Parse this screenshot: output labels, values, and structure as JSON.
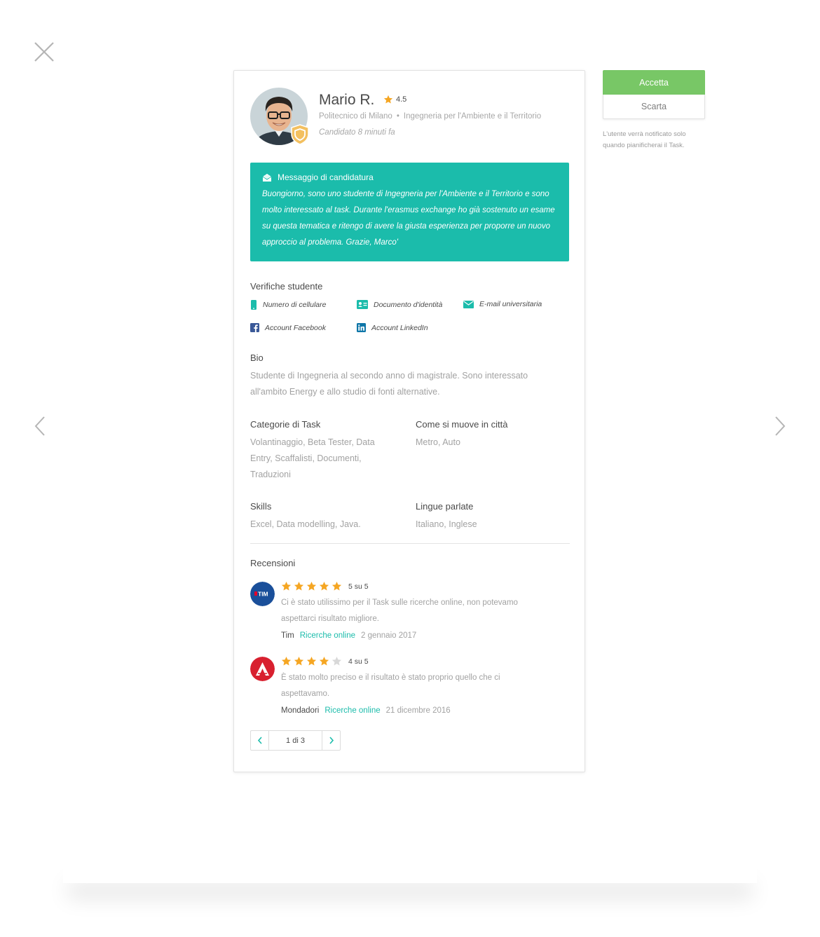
{
  "candidate": {
    "name": "Mario R.",
    "rating": "4.5",
    "university": "Politecnico di Milano",
    "separator": "•",
    "course": "Ingegneria per l'Ambiente e il Territorio",
    "applied": "Candidato 8 minuti fa"
  },
  "message": {
    "title": "Messaggio di candidatura",
    "text": "Buongiorno, sono uno studente di Ingegneria per l'Ambiente e il Territorio e sono molto interessato al task. Durante l'erasmus exchange ho già sostenuto un esame su questa tematica e ritengo di avere la giusta esperienza per proporre un nuovo approccio al problema. Grazie, Marco'"
  },
  "verifications": {
    "title": "Verifiche studente",
    "phone": "Numero di cellulare",
    "id_doc": "Documento d'identità",
    "email": "E-mail universitaria",
    "facebook": "Account Facebook",
    "linkedin": "Account LinkedIn"
  },
  "bio": {
    "title": "Bio",
    "text": "Studente di Ingegneria al secondo anno di magistrale. Sono interessato all'ambito Energy e allo studio di fonti alternative."
  },
  "categories": {
    "title": "Categorie di Task",
    "text": "Volantinaggio, Beta Tester, Data Entry, Scaffalisti, Documenti, Traduzioni"
  },
  "transport": {
    "title": "Come si muove in città",
    "text": "Metro, Auto"
  },
  "skills": {
    "title": "Skills",
    "text": "Excel, Data modelling, Java."
  },
  "languages": {
    "title": "Lingue parlate",
    "text": "Italiano, Inglese"
  },
  "reviews": {
    "title": "Recensioni",
    "items": [
      {
        "logo_text": "TIM",
        "stars": 5,
        "score": "5 su 5",
        "text": "Ci è stato utilissimo per il Task sulle ricerche online, non potevamo aspettarci risultato migliore.",
        "company": "Tim",
        "category": "Ricerche online",
        "date": "2 gennaio 2017"
      },
      {
        "logo_text": "",
        "stars": 4,
        "score": "4 su 5",
        "text": "È stato molto preciso e il risultato è stato proprio quello che ci aspettavamo.",
        "company": "Mondadori",
        "category": "Ricerche online",
        "date": "21 dicembre 2016"
      }
    ],
    "pager": "1 di 3"
  },
  "actions": {
    "accept": "Accetta",
    "discard": "Scarta",
    "note": "L'utente verrà notificato solo quando pianificherai il Task."
  },
  "colors": {
    "teal": "#1bbcab",
    "green": "#78c766",
    "star": "#f5a623",
    "star_empty": "#d8d8d8",
    "tim_blue": "#1a4f9a",
    "mondadori_red": "#d8202f"
  }
}
